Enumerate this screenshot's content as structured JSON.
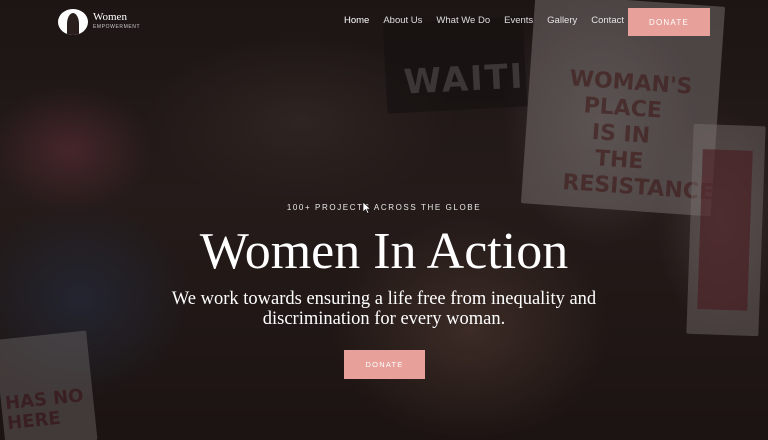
{
  "brand": {
    "title": "Women",
    "subtitle": "EMPOWERMENT"
  },
  "nav": {
    "items": [
      {
        "label": "Home",
        "active": true
      },
      {
        "label": "About Us"
      },
      {
        "label": "What We Do"
      },
      {
        "label": "Events"
      },
      {
        "label": "Gallery"
      },
      {
        "label": "Contact"
      }
    ],
    "donate_label": "DONATE"
  },
  "hero": {
    "kicker": "100+ PROJECTS ACROSS THE GLOBE",
    "title": "Women In Action",
    "subtitle": "We work towards ensuring a life free from inequality and discrimination for every woman.",
    "cta_label": "DONATE"
  },
  "background_signs": {
    "sign_1": "WAITI",
    "sign_2": "WOMAN'S PLACE IS IN THE RESISTANCE",
    "sign_4": "HAS NO HERE"
  },
  "colors": {
    "accent": "#e7a19a",
    "text": "#ffffff"
  }
}
